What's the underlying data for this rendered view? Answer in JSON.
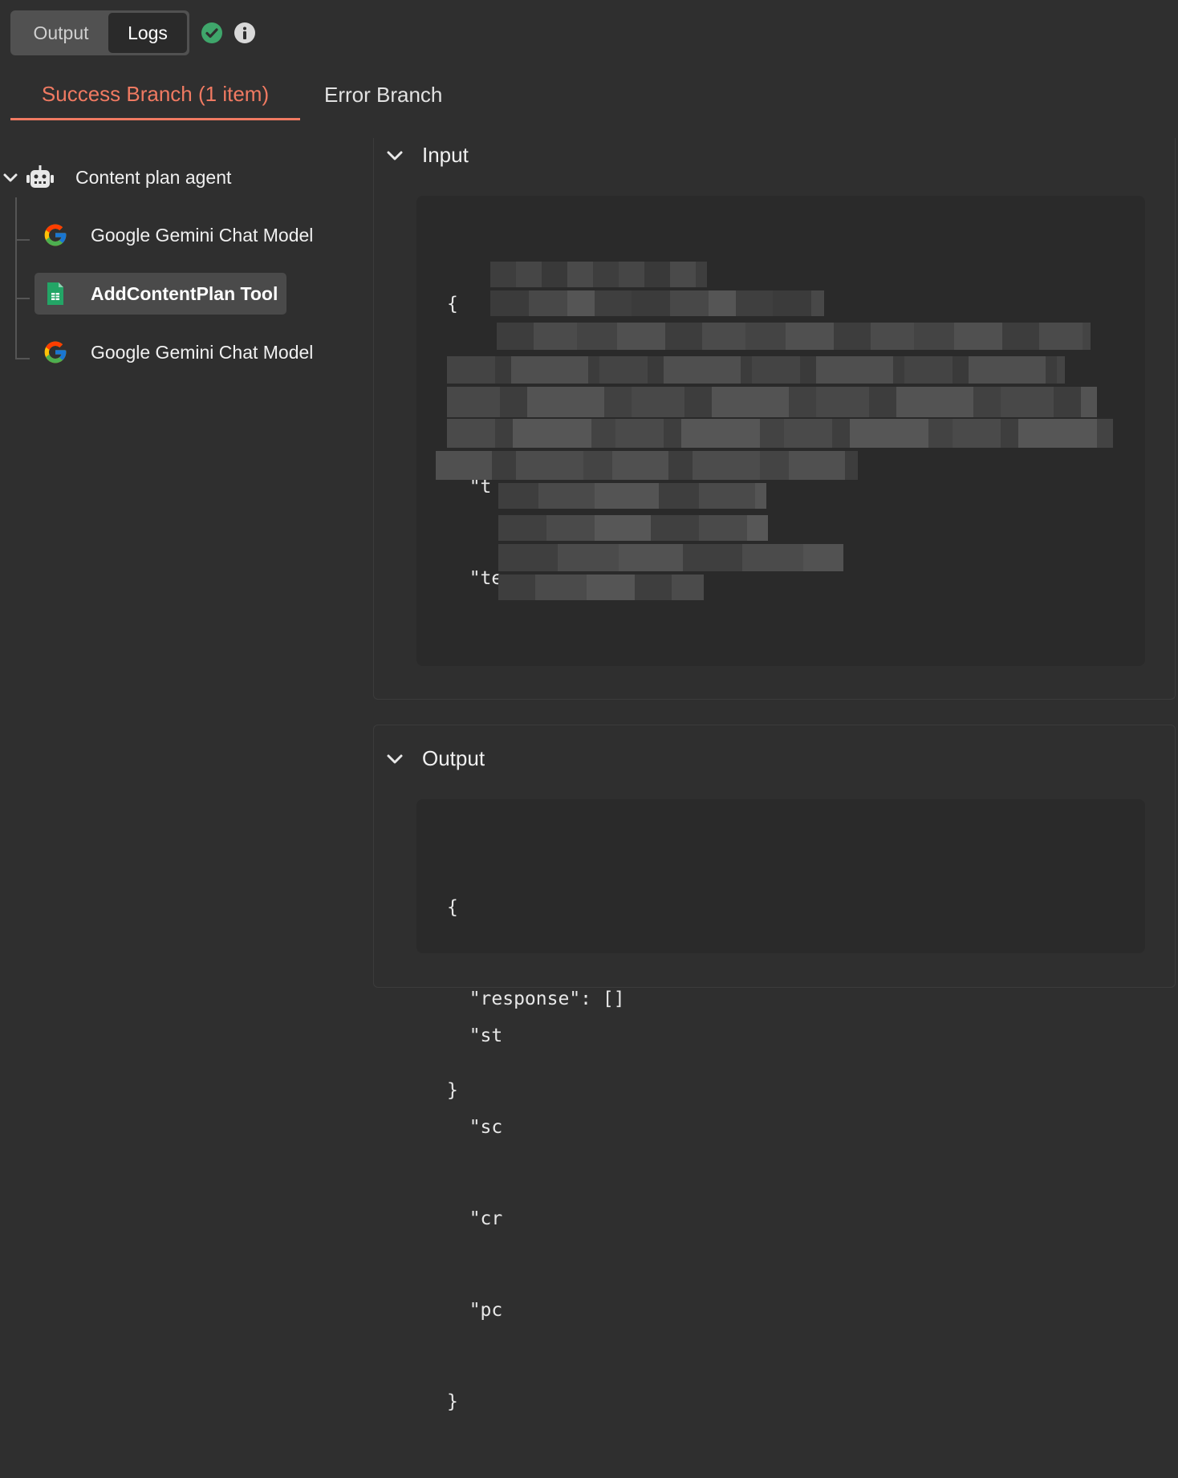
{
  "header": {
    "view_toggle": {
      "output_label": "Output",
      "logs_label": "Logs"
    },
    "status_icon": "check-circle-icon",
    "info_icon": "info-icon"
  },
  "branch_tabs": [
    {
      "label": "Success Branch (1 item)",
      "active": true
    },
    {
      "label": "Error Branch",
      "active": false
    }
  ],
  "tree": {
    "root": {
      "label": "Content plan agent",
      "icon": "robot-icon",
      "expanded": true
    },
    "children": [
      {
        "label": "Google Gemini Chat Model",
        "icon": "google-icon",
        "selected": false
      },
      {
        "label": "AddContentPlan Tool",
        "icon": "google-sheets-icon",
        "selected": true
      },
      {
        "label": "Google Gemini Chat Model",
        "icon": "google-icon",
        "selected": false
      }
    ]
  },
  "input_panel": {
    "title": "Input",
    "code_lines": [
      "{",
      "  \"d",
      "  \"t",
      "  \"te",
      "",
      "",
      "",
      "",
      "  \"st",
      "  \"sc",
      "  \"cr",
      "  \"pc",
      "}"
    ]
  },
  "output_panel": {
    "title": "Output",
    "code_lines": [
      "{",
      "  \"response\": []",
      "}"
    ]
  },
  "colors": {
    "background": "#2f2f2f",
    "accent": "#f07a62",
    "success": "#3fa66b",
    "code_bg": "#2a2a2a",
    "selected_bg": "#4a4a4a"
  }
}
